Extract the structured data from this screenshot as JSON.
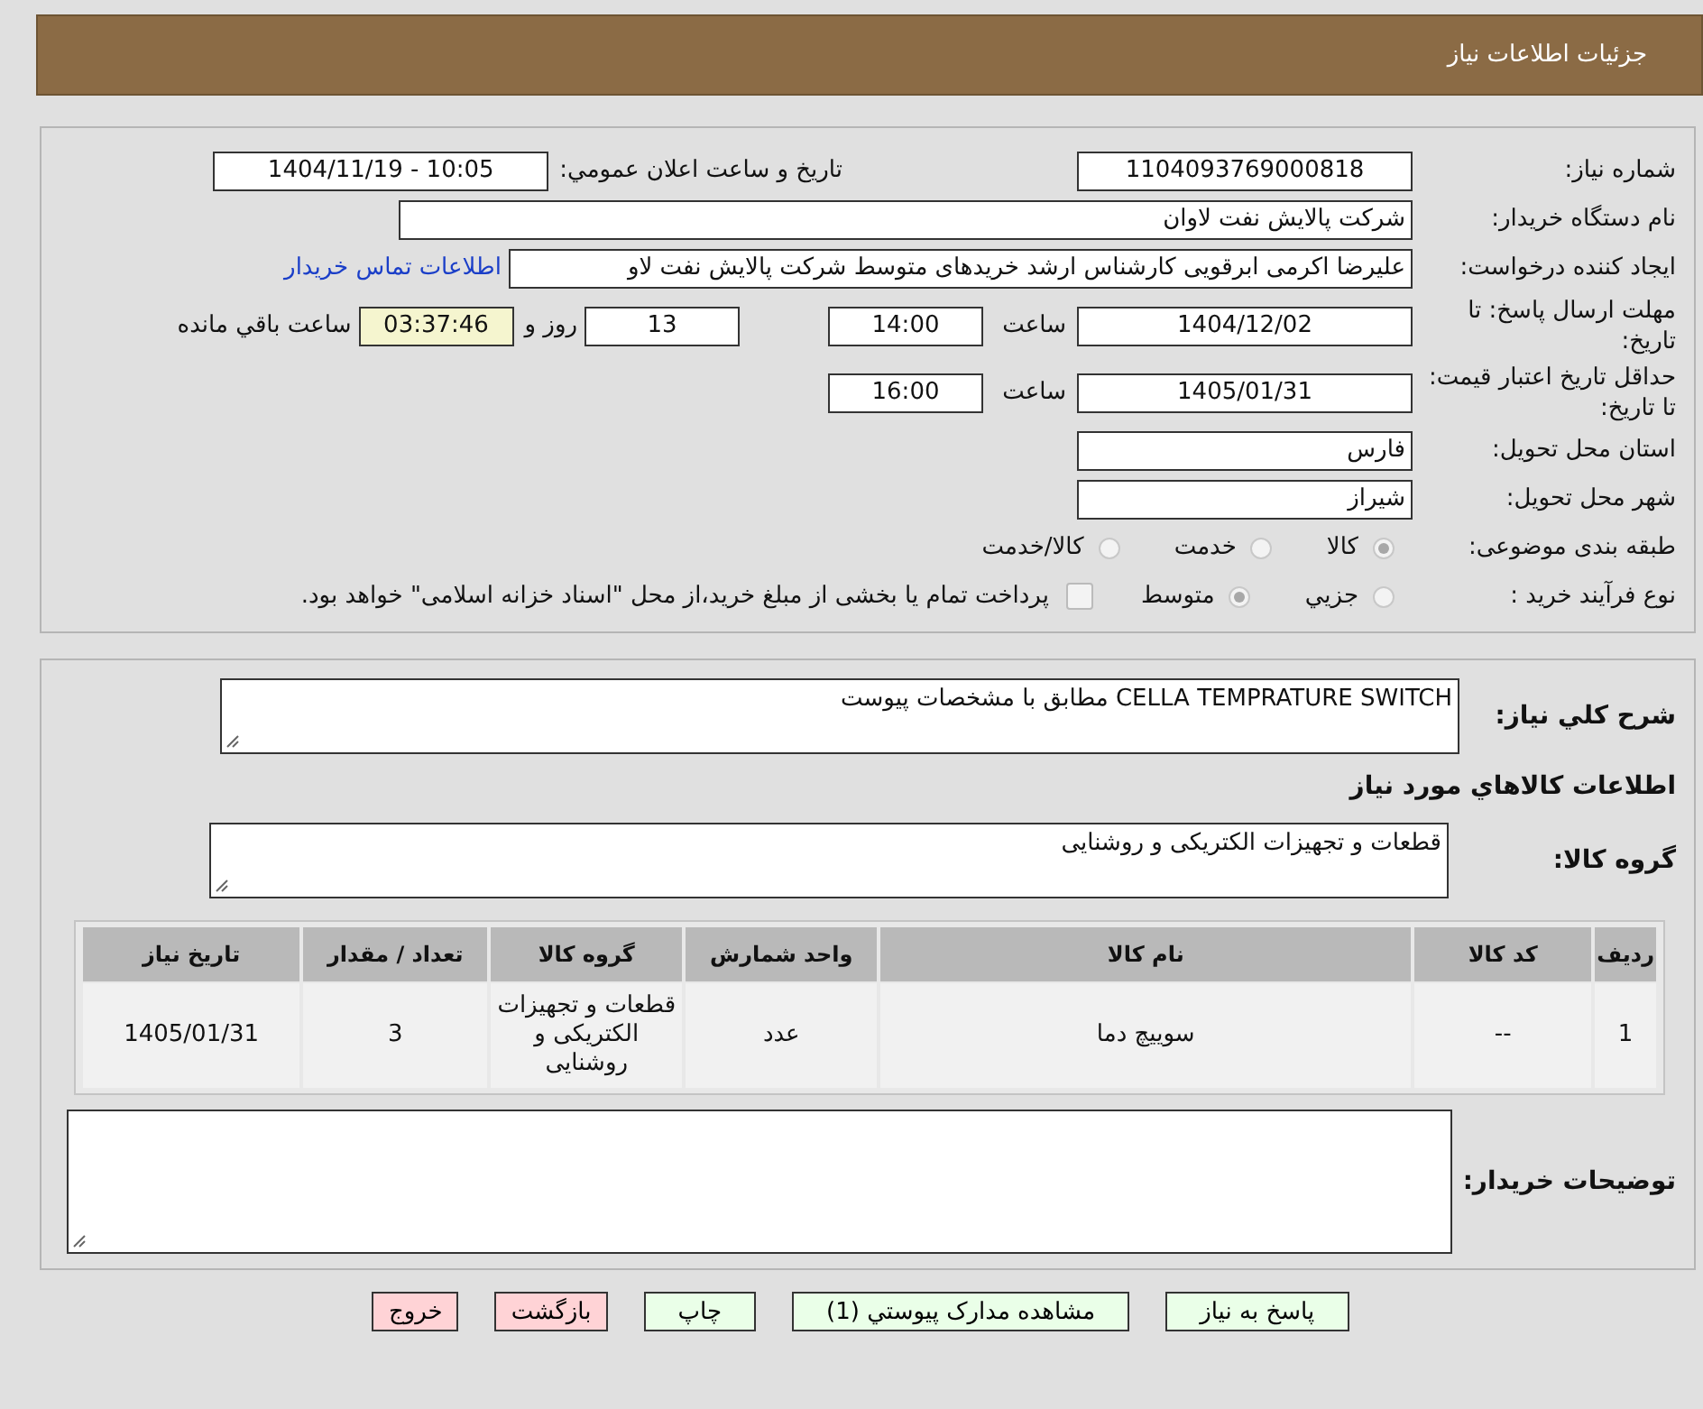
{
  "header": {
    "title": "جزئيات اطلاعات نياز"
  },
  "need_number": {
    "label": "شماره نياز:",
    "value": "1104093769000818"
  },
  "announce": {
    "label": "تاريخ و ساعت اعلان عمومي:",
    "value": "1404/11/19 - 10:05"
  },
  "buyer": {
    "label": "نام دستگاه خريدار:",
    "value": "شرکت پالایش نفت لاوان"
  },
  "requester": {
    "label": "ايجاد كننده درخواست:",
    "value": "علیرضا اکرمی ابرقویی کارشناس ارشد خریدهای متوسط شرکت پالایش نفت لاو",
    "contact_link": "اطلاعات تماس خريدار"
  },
  "deadline": {
    "label": "مهلت ارسال پاسخ: تا تاريخ:",
    "date": "1404/12/02",
    "time_label": "ساعت",
    "time": "14:00",
    "days": "13",
    "days_label": "روز و",
    "remaining": "03:37:46",
    "remaining_label": "ساعت باقي مانده"
  },
  "validity": {
    "label": "حداقل تاريخ اعتبار قيمت: تا تاريخ:",
    "date": "1405/01/31",
    "time_label": "ساعت",
    "time": "16:00"
  },
  "province": {
    "label": "استان محل تحويل:",
    "value": "فارس"
  },
  "city": {
    "label": "شهر محل تحويل:",
    "value": "شيراز"
  },
  "category": {
    "label": "طبقه بندی موضوعی:",
    "options": [
      {
        "label": "كالا",
        "selected": true
      },
      {
        "label": "خدمت",
        "selected": false
      },
      {
        "label": "كالا/خدمت",
        "selected": false
      }
    ]
  },
  "process": {
    "label": "نوع فرآيند خريد :",
    "options": [
      {
        "label": "جزيي",
        "selected": false
      },
      {
        "label": "متوسط",
        "selected": true
      }
    ],
    "payment": {
      "checked": false,
      "text": "پرداخت تمام يا بخشی از مبلغ خريد،از محل \"اسناد خزانه اسلامی\" خواهد بود."
    }
  },
  "description": {
    "label": "شرح كلي نياز:",
    "value": "CELLA TEMPRATURE SWITCH مطابق با مشخصات پیوست"
  },
  "items_heading": "اطلاعات كالاهاي مورد نياز",
  "goods_group": {
    "label": "گروه كالا:",
    "value": "قطعات و تجهیزات الکتریکی و روشنایی"
  },
  "table": {
    "columns": [
      "رديف",
      "كد كالا",
      "نام كالا",
      "واحد شمارش",
      "گروه كالا",
      "تعداد / مقدار",
      "تاريخ نياز"
    ],
    "rows": [
      [
        "1",
        "--",
        "سوییچ دما",
        "عدد",
        "قطعات و تجهیزات الکتریکی و روشنایی",
        "3",
        "1405/01/31"
      ]
    ]
  },
  "notes": {
    "label": "توضيحات خريدار:"
  },
  "buttons": [
    {
      "label": "پاسخ به نياز",
      "kind": "green"
    },
    {
      "label": "مشاهده مدارک پيوستي (1)",
      "kind": "green"
    },
    {
      "label": "چاپ",
      "kind": "green"
    },
    {
      "label": "بازگشت",
      "kind": "red"
    },
    {
      "label": "خروج",
      "kind": "red"
    }
  ]
}
